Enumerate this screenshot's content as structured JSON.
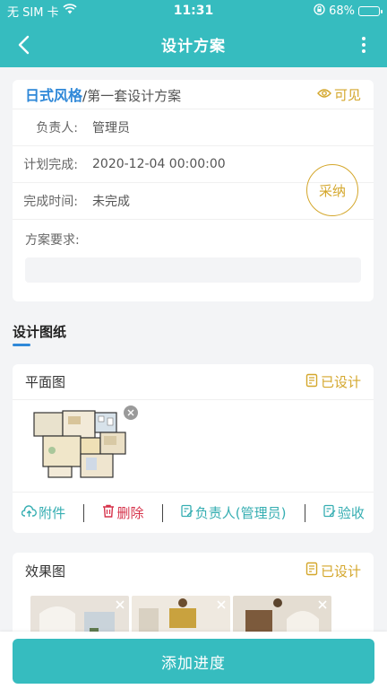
{
  "status": {
    "carrier": "无 SIM 卡",
    "time": "11:31",
    "battery": "68%",
    "battery_level": 0.68
  },
  "nav": {
    "title": "设计方案"
  },
  "scheme": {
    "style": "日式风格",
    "separator": "/",
    "name": "第一套设计方案",
    "visibility": "可见",
    "adopt_label": "采纳",
    "rows": [
      {
        "label": "负责人:",
        "value": "管理员"
      },
      {
        "label": "计划完成:",
        "value": "2020-12-04 00:00:00"
      },
      {
        "label": "完成时间:",
        "value": "未完成"
      }
    ],
    "requirement_label": "方案要求:",
    "requirement_value": ""
  },
  "drawings": {
    "section_title": "设计图纸",
    "plan": {
      "name": "平面图",
      "status": "已设计",
      "actions": {
        "attachment": "附件",
        "delete": "删除",
        "owner": "负责人(管理员)",
        "accept": "验收"
      }
    },
    "effect": {
      "name": "效果图",
      "status": "已设计"
    }
  },
  "bottom": {
    "add_progress": "添加进度"
  },
  "colors": {
    "primary": "#36bcbf",
    "accent_blue": "#2f88d8",
    "gold": "#d4a72c",
    "danger": "#d6324a"
  }
}
